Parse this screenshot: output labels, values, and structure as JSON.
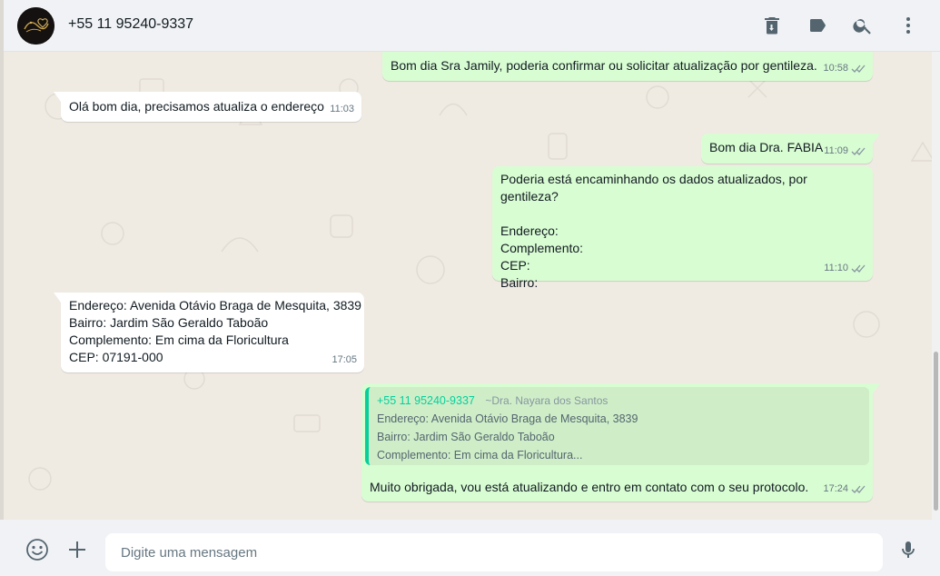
{
  "header": {
    "contact_name": "+55 11 95240-9337",
    "icons": [
      "delete-icon",
      "label-icon",
      "search-icon",
      "menu-icon"
    ]
  },
  "messages": [
    {
      "direction": "out",
      "text": "Bom dia Sra Jamily, poderia confirmar ou solicitar atualização por gentileza.",
      "time": "10:58",
      "status": "read"
    },
    {
      "direction": "in",
      "text": "Olá bom dia, precisamos atualiza o endereço",
      "time": "11:03"
    },
    {
      "direction": "out",
      "text": "Bom dia Dra. FABIA",
      "time": "11:09",
      "status": "read"
    },
    {
      "direction": "out",
      "text": "Poderia está encaminhando os dados atualizados, por gentileza?\n\nEndereço:\nComplemento:\nCEP:\nBairro:",
      "time": "11:10",
      "status": "read"
    },
    {
      "direction": "in",
      "text": "Endereço: Avenida Otávio Braga de Mesquita, 3839\nBairro: Jardim São Geraldo Taboão\nComplemento: Em cima da Floricultura\nCEP: 07191-000",
      "time": "17:05"
    },
    {
      "direction": "out",
      "quote": {
        "author": "+55 11 95240-9337",
        "push_name": "~Dra. Nayara dos Santos",
        "lines": [
          "Endereço: Avenida Otávio Braga de Mesquita, 3839",
          "Bairro: Jardim São Geraldo Taboão",
          "Complemento: Em cima da Floricultura..."
        ]
      },
      "text": "Muito obrigada, vou está atualizando e entro em contato com o seu protocolo.",
      "time": "17:24",
      "status": "read"
    }
  ],
  "composer": {
    "placeholder": "Digite uma mensagem"
  },
  "colors": {
    "header_bg": "#f0f2f5",
    "chat_bg": "#efeae2",
    "incoming_bg": "#ffffff",
    "outgoing_bg": "#d9fdd3",
    "quote_accent": "#06cf9c",
    "icon_gray": "#54656f"
  }
}
